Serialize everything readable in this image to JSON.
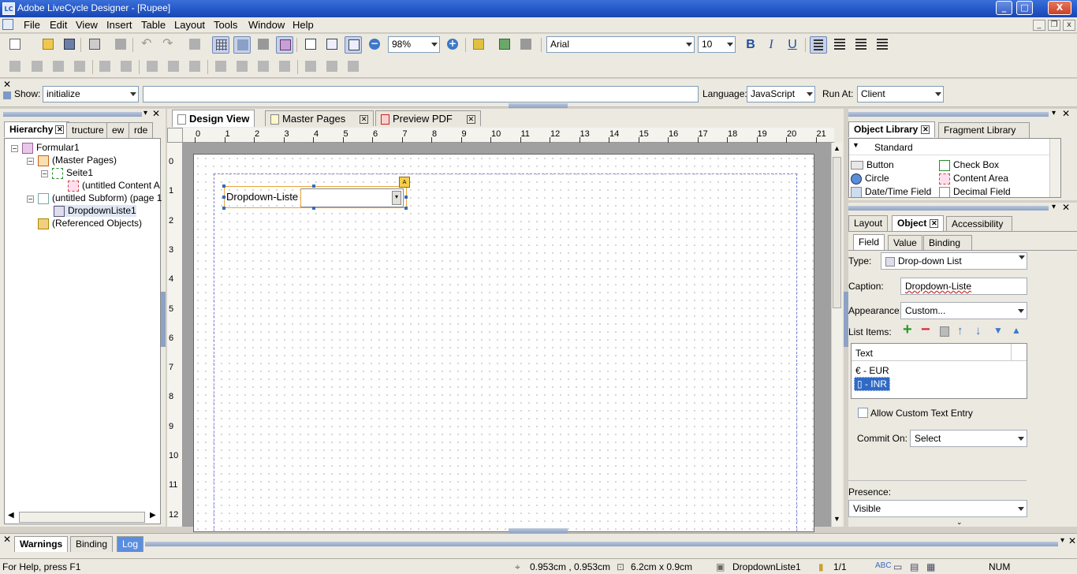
{
  "window": {
    "app_icon": "LC",
    "title": "Adobe LiveCycle Designer - [Rupee]",
    "minimize": "_",
    "maximize": "□",
    "close": "X"
  },
  "menu": [
    "File",
    "Edit",
    "View",
    "Insert",
    "Table",
    "Layout",
    "Tools",
    "Window",
    "Help"
  ],
  "toolbar": {
    "zoom": "98%",
    "font": "Arial",
    "size": "10",
    "bold": "B",
    "italic": "I",
    "underline": "U"
  },
  "script_bar": {
    "show_label": "Show:",
    "show_value": "initialize",
    "language_label": "Language:",
    "language_value": "JavaScript",
    "run_at_label": "Run At:",
    "run_at_value": "Client"
  },
  "left_panel": {
    "tabs": [
      "Hierarchy",
      "tructure",
      "ew",
      "rde"
    ],
    "tree": [
      "Formular1",
      "(Master Pages)",
      "Seite1",
      "(untitled Content A",
      "(untitled Subform) (page 1",
      "DropdownListe1",
      "(Referenced Objects)"
    ]
  },
  "doc_tabs": [
    "Design View",
    "Master Pages",
    "Preview PDF"
  ],
  "ruler_top": [
    "0",
    "1",
    "2",
    "3",
    "4",
    "5",
    "6",
    "7",
    "8",
    "9",
    "10",
    "11",
    "12",
    "13",
    "14",
    "15",
    "16",
    "17",
    "18",
    "19",
    "20",
    "21"
  ],
  "ruler_left": [
    "0",
    "1",
    "2",
    "3",
    "4",
    "5",
    "6",
    "7",
    "8",
    "9",
    "10",
    "11",
    "12"
  ],
  "form": {
    "caption": "Dropdown-Liste"
  },
  "object_library": {
    "tabs": [
      "Object Library",
      "Fragment Library"
    ],
    "category": "Standard",
    "items": [
      "Button",
      "Check Box",
      "Circle",
      "Content Area",
      "Date/Time Field",
      "Decimal Field"
    ]
  },
  "object_panel": {
    "tabs": [
      "Layout",
      "Object",
      "Accessibility"
    ],
    "subtabs": [
      "Field",
      "Value",
      "Binding"
    ],
    "type_label": "Type:",
    "type_value": "Drop-down List",
    "caption_label": "Caption:",
    "caption_value": "Dropdown-Liste",
    "appearance_label": "Appearance:",
    "appearance_value": "Custom...",
    "list_items_label": "List Items:",
    "list_header": "Text",
    "list_items": [
      "€ - EUR",
      "\u0000 - INR"
    ],
    "allow_custom": "Allow Custom Text Entry",
    "commit_label": "Commit On:",
    "commit_value": "Select",
    "presence_label": "Presence:",
    "presence_value": "Visible"
  },
  "bottom_tabs": [
    "Warnings",
    "Binding",
    "Log"
  ],
  "status": {
    "help": "For Help, press F1",
    "coords": "0.953cm , 0.953cm",
    "size": "6.2cm x 0.9cm",
    "object": "DropdownListe1",
    "page": "1/1",
    "num": "NUM"
  },
  "colors": {
    "title_bar": "#2457c8",
    "selection": "#316ac5",
    "field_border": "#e8a33d"
  }
}
